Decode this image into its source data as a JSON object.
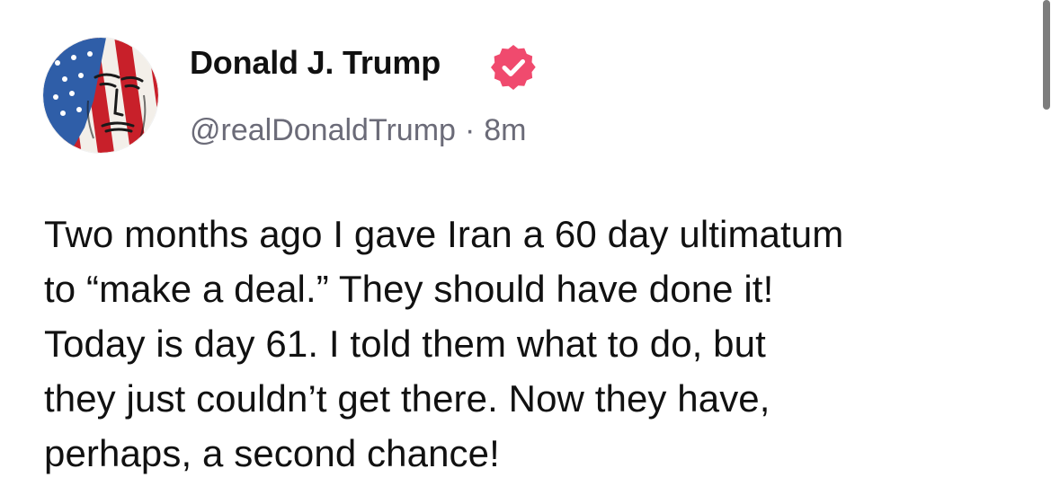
{
  "author": {
    "display_name": "Donald J. Trump",
    "handle": "@realDonaldTrump",
    "separator": "·",
    "time_ago": "8m",
    "avatar_icon": "user-avatar-flag-portrait",
    "verified_icon": "verified-badge-icon"
  },
  "post": {
    "lines": [
      "Two months ago I gave Iran a 60 day ultimatum",
      "to “make a deal.” They should have done it!",
      "Today is day 61. I told them what to do, but",
      "they just couldn’t get there. Now they have,",
      "perhaps, a second chance!"
    ]
  },
  "colors": {
    "text": "#111111",
    "muted": "#6b6b78",
    "verified": "#f04a6e",
    "scrollbar": "#7d7d7d"
  }
}
